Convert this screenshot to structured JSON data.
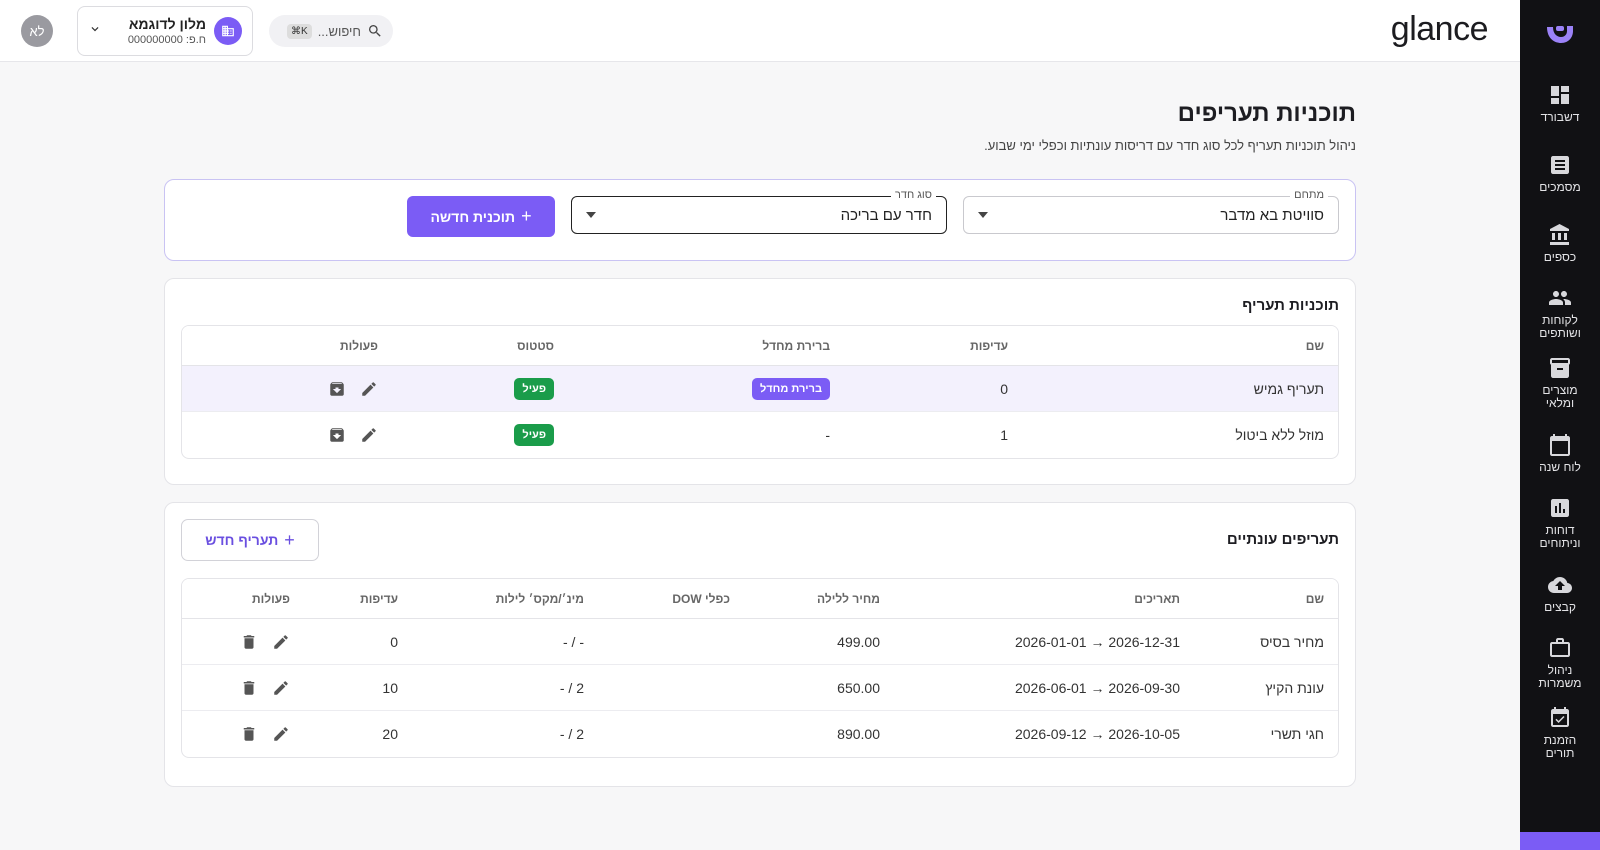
{
  "sidebar": {
    "items": [
      {
        "label": "דשבורד",
        "icon": "dashboard-icon"
      },
      {
        "label": "מסמכים",
        "icon": "documents-icon"
      },
      {
        "label": "כספים",
        "icon": "bank-icon"
      },
      {
        "label": "לקוחות ושותפים",
        "icon": "people-icon"
      },
      {
        "label": "מוצרים ומלאי",
        "icon": "archive-icon"
      },
      {
        "label": "לוח שנה",
        "icon": "calendar-icon"
      },
      {
        "label": "דוחות וניתוחים",
        "icon": "chart-icon"
      },
      {
        "label": "קבצים",
        "icon": "cloud-upload-icon"
      },
      {
        "label": "ניהול משמרות",
        "icon": "briefcase-icon"
      },
      {
        "label": "הזמנת תורים",
        "icon": "calendar-check-icon"
      }
    ]
  },
  "header": {
    "brand": "glance",
    "search_placeholder": "חיפוש...",
    "shortcut": "⌘K",
    "hotel_name": "מלון לדוגמא",
    "hotel_id": "ח.פ: 000000000",
    "avatar_initials": "לא"
  },
  "page": {
    "title": "תוכניות תעריפים",
    "subtitle": "ניהול תוכניות תעריף לכל סוג חדר עם דריסות עונתיות וכפלי ימי שבוע."
  },
  "filters": {
    "complex_label": "מתחם",
    "complex_value": "סוויטת בא מדבר",
    "room_type_label": "סוג חדר",
    "room_type_value": "חדר עם בריכה",
    "new_plan_button": "תוכנית חדשה"
  },
  "rate_plans": {
    "title": "תוכניות תעריף",
    "headers": {
      "name": "שם",
      "priority": "עדיפות",
      "default": "ברירת מחדל",
      "status": "סטטוס",
      "actions": "פעולות"
    },
    "rows": [
      {
        "name": "תעריף גמיש",
        "priority": "0",
        "default": "ברירת מחדל",
        "status": "פעיל"
      },
      {
        "name": "מוזל ללא ביטול",
        "priority": "1",
        "default": "-",
        "status": "פעיל"
      }
    ]
  },
  "seasonal": {
    "title": "תעריפים עונתיים",
    "new_button": "תעריף חדש",
    "headers": {
      "name": "שם",
      "dates": "תאריכים",
      "price": "מחיר ללילה",
      "dow": "כפלי DOW",
      "minmax": "מינ׳/מקס׳ לילות",
      "priority": "עדיפות",
      "actions": "פעולות"
    },
    "rows": [
      {
        "name": "מחיר בסיס",
        "dates": "2026-01-01 → 2026-12-31",
        "price": "499.00",
        "dow": "",
        "minmax": "- / -",
        "priority": "0"
      },
      {
        "name": "עונת הקיץ",
        "dates": "2026-06-01 → 2026-09-30",
        "price": "650.00",
        "dow": "",
        "minmax": "2 / -",
        "priority": "10"
      },
      {
        "name": "חגי תשרי",
        "dates": "2026-09-12 → 2026-10-05",
        "price": "890.00",
        "dow": "",
        "minmax": "2 / -",
        "priority": "20"
      }
    ]
  },
  "colors": {
    "accent": "#7b5cf5",
    "success": "#1a9c4a",
    "sidebar": "#111114"
  }
}
